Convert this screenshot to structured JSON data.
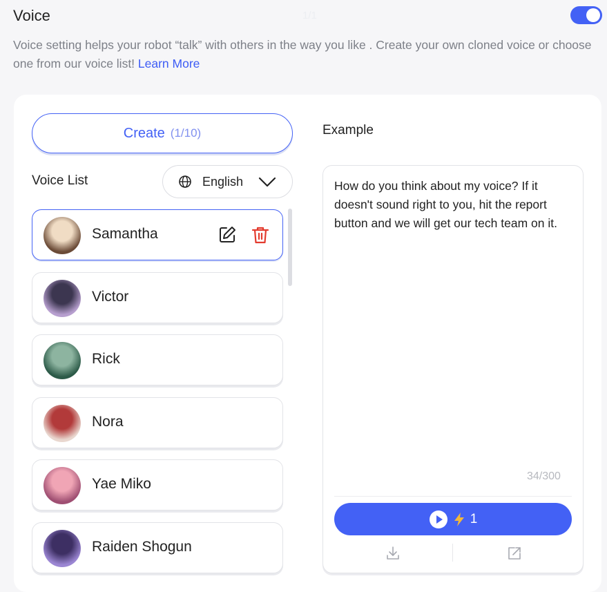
{
  "header": {
    "title": "Voice",
    "page_indicator": "1/1",
    "toggle_on": true
  },
  "description": {
    "text": "Voice setting helps your robot “talk” with others in the way you like . Create your own cloned voice or choose one from our voice list! ",
    "link_label": "Learn More"
  },
  "create": {
    "label": "Create",
    "count": "(1/10)"
  },
  "voice_list": {
    "label": "Voice List",
    "language": "English",
    "items": [
      {
        "name": "Samantha",
        "selected": true,
        "avatar_colors": [
          "#f0dcc4",
          "#6b4b37"
        ]
      },
      {
        "name": "Victor",
        "selected": false,
        "avatar_colors": [
          "#3c3650",
          "#b79fcf"
        ]
      },
      {
        "name": "Rick",
        "selected": false,
        "avatar_colors": [
          "#8db4a0",
          "#2c5a48"
        ]
      },
      {
        "name": "Nora",
        "selected": false,
        "avatar_colors": [
          "#b23a3a",
          "#e9d7cf"
        ]
      },
      {
        "name": "Yae Miko",
        "selected": false,
        "avatar_colors": [
          "#f0a5b5",
          "#9f4f72"
        ]
      },
      {
        "name": "Raiden Shogun",
        "selected": false,
        "avatar_colors": [
          "#3d2f63",
          "#9b86d3"
        ]
      }
    ]
  },
  "example": {
    "label": "Example",
    "text": "How do you think about my voice?  If it doesn't sound right to you, hit the report button and we will get our tech team on it.",
    "char_count": "34/300",
    "cost": "1"
  },
  "colors": {
    "accent": "#4361f5",
    "delete": "#e33b2e",
    "lightning": "#f2b73c"
  }
}
